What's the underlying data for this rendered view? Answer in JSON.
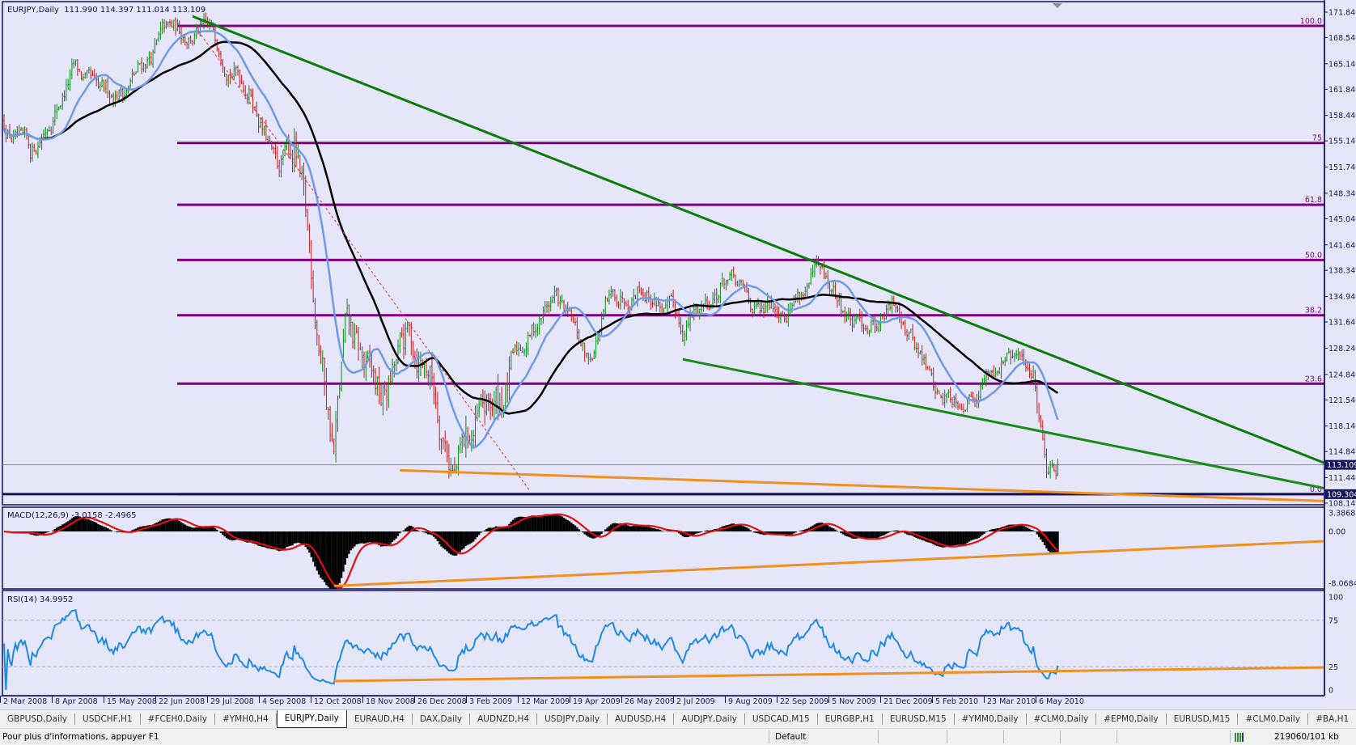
{
  "window": {
    "symbol_header": "EURJPY,Daily  111.990 114.397 111.014 113.109"
  },
  "price_axis": {
    "ticks": [
      "171.840",
      "168.540",
      "165.140",
      "161.840",
      "158.440",
      "155.140",
      "151.740",
      "148.340",
      "145.040",
      "141.640",
      "138.340",
      "134.940",
      "131.640",
      "128.240",
      "124.840",
      "121.540",
      "118.140",
      "114.840",
      "111.440",
      "108.140"
    ],
    "current_price": "113.109",
    "line_price": "109.304"
  },
  "fibonacci": {
    "high": 170.06,
    "low": 109.304,
    "levels": [
      {
        "label": "100.0",
        "ratio": 1.0
      },
      {
        "label": "75",
        "ratio": 0.75
      },
      {
        "label": "61.8",
        "ratio": 0.618
      },
      {
        "label": "50.0",
        "ratio": 0.5
      },
      {
        "label": "38.2",
        "ratio": 0.382
      },
      {
        "label": "23.6",
        "ratio": 0.236
      },
      {
        "label": "0.0",
        "ratio": 0.0
      }
    ]
  },
  "chart_data": {
    "type": "line",
    "title": "EURJPY,Daily",
    "price_range": [
      108.14,
      171.84
    ],
    "price_path_bar_price": [
      [
        0,
        157.6
      ],
      [
        14,
        152.6
      ],
      [
        25,
        158.7
      ],
      [
        37,
        164.3
      ],
      [
        51,
        159.9
      ],
      [
        67,
        162.7
      ],
      [
        85,
        168.8
      ],
      [
        103,
        169.4
      ],
      [
        115,
        167.7
      ],
      [
        131,
        162.1
      ],
      [
        145,
        150.9
      ],
      [
        154,
        155.4
      ],
      [
        163,
        137.5
      ],
      [
        175,
        115.1
      ],
      [
        181,
        129.6
      ],
      [
        200,
        120.7
      ],
      [
        214,
        128.5
      ],
      [
        225,
        126.3
      ],
      [
        239,
        112.8
      ],
      [
        253,
        118.4
      ],
      [
        262,
        120.7
      ],
      [
        278,
        129.6
      ],
      [
        292,
        135.2
      ],
      [
        310,
        126.3
      ],
      [
        319,
        133.0
      ],
      [
        337,
        137.5
      ],
      [
        360,
        130.8
      ],
      [
        383,
        137.5
      ],
      [
        402,
        131.9
      ],
      [
        431,
        137.5
      ],
      [
        452,
        130.8
      ],
      [
        475,
        134.1
      ],
      [
        496,
        121.8
      ],
      [
        512,
        123.0
      ],
      [
        530,
        127.4
      ],
      [
        546,
        125.2
      ],
      [
        553,
        114.0
      ],
      [
        559,
        113.109
      ]
    ],
    "trendlines": [
      {
        "name": "upper-resistance",
        "color": "#0a7d0a",
        "from": [
          100,
          171.3
        ],
        "to": [
          702,
          113.2
        ]
      },
      {
        "name": "lower-support",
        "color": "#1a8a1a",
        "from": [
          360,
          126.8
        ],
        "to": [
          702,
          110.0
        ]
      },
      {
        "name": "price-orange-support",
        "color": "#f0901e",
        "from": [
          210,
          112.4
        ],
        "to": [
          702,
          108.4
        ]
      },
      {
        "name": "fib-dotted",
        "color": "#e03030",
        "from": [
          103,
          169.4
        ],
        "to": [
          279,
          109.7
        ]
      }
    ],
    "macd": {
      "label": "MACD(12,26,9) -3.0158 -2.4965",
      "range": [
        -8.0684,
        3.3868
      ],
      "ticks": [
        "3.3868",
        "0.00",
        "-8.0684"
      ],
      "trendline": {
        "from": [
          175,
          -8.5
        ],
        "to": [
          702,
          -1.5
        ],
        "color": "#f0901e"
      }
    },
    "rsi": {
      "label": "RSI(14) 34.9952",
      "range": [
        0,
        100
      ],
      "ticks": [
        "100",
        "75",
        "25",
        "0"
      ],
      "trendline": {
        "from": [
          175,
          9.6
        ],
        "to": [
          702,
          24.3
        ],
        "color": "#f0901e"
      }
    },
    "x_labels": [
      "2 Mar 2008",
      "8 Apr 2008",
      "15 May 2008",
      "22 Jun 2008",
      "29 Jul 2008",
      "4 Sep 2008",
      "12 Oct 2008",
      "18 Nov 2008",
      "26 Dec 2008",
      "3 Feb 2009",
      "12 Mar 2009",
      "19 Apr 2009",
      "26 May 2009",
      "2 Jul 2009",
      "9 Aug 2009",
      "22 Sep 2009",
      "5 Nov 2009",
      "21 Dec 2009",
      "5 Feb 2010",
      "23 Mar 2010",
      "6 May 2010"
    ]
  },
  "tabs": [
    "GBPUSD,Daily",
    "USDCHF,H1",
    "#FCEH0,Daily",
    "#YMH0,H4",
    "EURJPY,Daily",
    "EURAUD,H4",
    "DAX,Daily",
    "AUDNZD,H4",
    "USDJPY,Daily",
    "AUDUSD,H4",
    "AUDJPY,Daily",
    "USDCAD,M15",
    "EURGBP,H1",
    "EURUSD,M15",
    "#YMM0,Daily",
    "#CLM0,Daily",
    "#EPM0,Daily",
    "EURUSD,M15",
    "#CLM0,Daily",
    "#BA,H1"
  ],
  "active_tab": "EURJPY,Daily",
  "tab_scroll": "◂ ▸",
  "status": {
    "help": "Pour plus d'informations, appuyer F1",
    "profile": "Default",
    "traffic": "219060/101 kb"
  }
}
